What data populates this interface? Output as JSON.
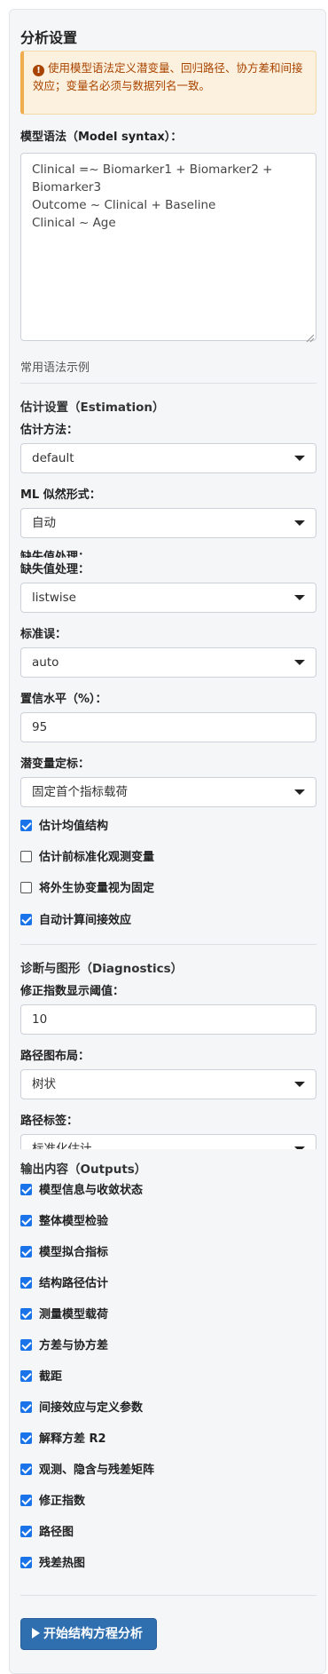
{
  "panel": {
    "title": "分析设置",
    "alert_text": "使用模型语法定义潜变量、回归路径、协方差和间接效应；变量名必须与数据列名一致。",
    "model_label": "模型语法（Model syntax）：",
    "model_text": "Clinical =~ Biomarker1 + Biomarker2 + Biomarker3\nOutcome ~ Clinical + Baseline\nClinical ~ Age",
    "examples_link": "常用语法示例"
  },
  "estimation": {
    "section_title": "估计设置（Estimation）",
    "method_label": "估计方法：",
    "method_value": "default",
    "ml_label": "ML 似然形式：",
    "ml_value": "自动",
    "missing_clipped": "缺失值处理：",
    "missing_label": "缺失值处理：",
    "missing_value": "listwise",
    "se_label": "标准误：",
    "se_value": "auto",
    "ci_label": "置信水平（%）：",
    "ci_value": "95",
    "latent_label": "潜变量定标：",
    "latent_value": "固定首个指标载荷",
    "checks": [
      {
        "label": "估计均值结构",
        "checked": true
      },
      {
        "label": "估计前标准化观测变量",
        "checked": false
      },
      {
        "label": "将外生协变量视为固定",
        "checked": false
      },
      {
        "label": "自动计算间接效应",
        "checked": true
      }
    ]
  },
  "diagnostics": {
    "section_title": "诊断与图形（Diagnostics）",
    "mi_label": "修正指数显示阈值：",
    "mi_value": "10",
    "layout_label": "路径图布局：",
    "layout_value": "树状",
    "edge_label": "路径标签：",
    "edge_value": "标准化估计"
  },
  "outputs": {
    "section_title": "输出内容（Outputs）",
    "items": [
      {
        "label": "模型信息与收敛状态",
        "checked": true
      },
      {
        "label": "整体模型检验",
        "checked": true
      },
      {
        "label": "模型拟合指标",
        "checked": true
      },
      {
        "label": "结构路径估计",
        "checked": true
      },
      {
        "label": "测量模型载荷",
        "checked": true
      },
      {
        "label": "方差与协方差",
        "checked": true
      },
      {
        "label": "截距",
        "checked": true
      },
      {
        "label": "间接效应与定义参数",
        "checked": true
      },
      {
        "label": "解释方差 R2",
        "checked": true
      },
      {
        "label": "观测、隐含与残差矩阵",
        "checked": true
      },
      {
        "label": "修正指数",
        "checked": true
      },
      {
        "label": "路径图",
        "checked": true
      },
      {
        "label": "残差热图",
        "checked": true
      }
    ]
  },
  "run_button": "开始结构方程分析",
  "colors": {
    "accent": "#1a73e8",
    "button": "#2f6fb0",
    "alert_bg": "#fcf1de",
    "alert_text": "#a94400"
  }
}
